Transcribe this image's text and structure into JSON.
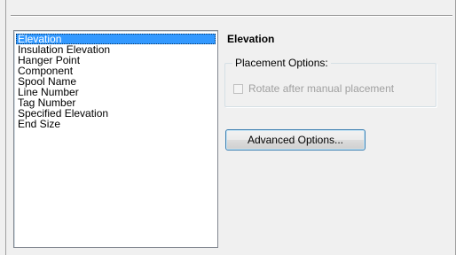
{
  "list": {
    "items": [
      {
        "label": "Elevation",
        "selected": true
      },
      {
        "label": "Insulation Elevation",
        "selected": false
      },
      {
        "label": "Hanger Point",
        "selected": false
      },
      {
        "label": "Component",
        "selected": false
      },
      {
        "label": "Spool Name",
        "selected": false
      },
      {
        "label": "Line Number",
        "selected": false
      },
      {
        "label": "Tag Number",
        "selected": false
      },
      {
        "label": "Specified Elevation",
        "selected": false
      },
      {
        "label": "End Size",
        "selected": false
      }
    ]
  },
  "details": {
    "title": "Elevation",
    "placement_group_label": "Placement Options:",
    "rotate_checkbox": {
      "label": "Rotate after manual placement",
      "checked": false,
      "enabled": false
    },
    "advanced_button_label": "Advanced Options..."
  },
  "colors": {
    "selection": "#3399ff",
    "background": "#f0f0f0",
    "disabled_text": "#a0a0a0"
  }
}
